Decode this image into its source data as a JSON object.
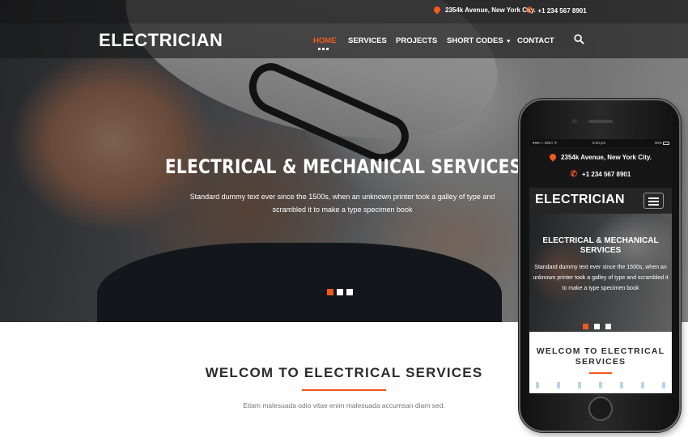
{
  "topbar": {
    "address": "2354k Avenue, New York City.",
    "phone": "+1 234 567 8901"
  },
  "nav": {
    "logo": "ELECTRICIAN",
    "items": [
      "HOME",
      "SERVICES",
      "PROJECTS",
      "SHORT CODES",
      "CONTACT"
    ],
    "active": "HOME"
  },
  "hero": {
    "title": "ELECTRICAL & MECHANICAL SERVICES",
    "subtitle": "Standard dummy text ever since the 1500s, when an unknown printer took a galley of type and scrambled it to make a type specimen book",
    "slides": 3,
    "active_slide": 1
  },
  "welcome": {
    "title": "WELCOM TO ELECTRICAL SERVICES",
    "text": "Etiam malesuada odio vitae enim malesuada accumsan diam sed."
  },
  "mobile": {
    "status": {
      "carrier": "●●●○○ IDEA ᯤ",
      "time": "9:20 pm",
      "battery": "90%"
    },
    "address": "2354k Avenue, New York City.",
    "phone": "+1 234 567 8901",
    "logo": "ELECTRICIAN",
    "hero_title": "ELECTRICAL & MECHANICAL SERVICES",
    "hero_subtitle": "Standard dummy text ever since the 1500s, when an unknown printer took a galley of type and scrambled it to make a type specimen book",
    "welcome_title": "WELCOM TO ELECTRICAL SERVICES"
  },
  "colors": {
    "accent": "#f05a1a",
    "dark": "#161616",
    "text": "#2b2b2b"
  },
  "icons": [
    "map-pin-icon",
    "phone-icon",
    "search-icon",
    "caret-down-icon",
    "menu-icon"
  ]
}
